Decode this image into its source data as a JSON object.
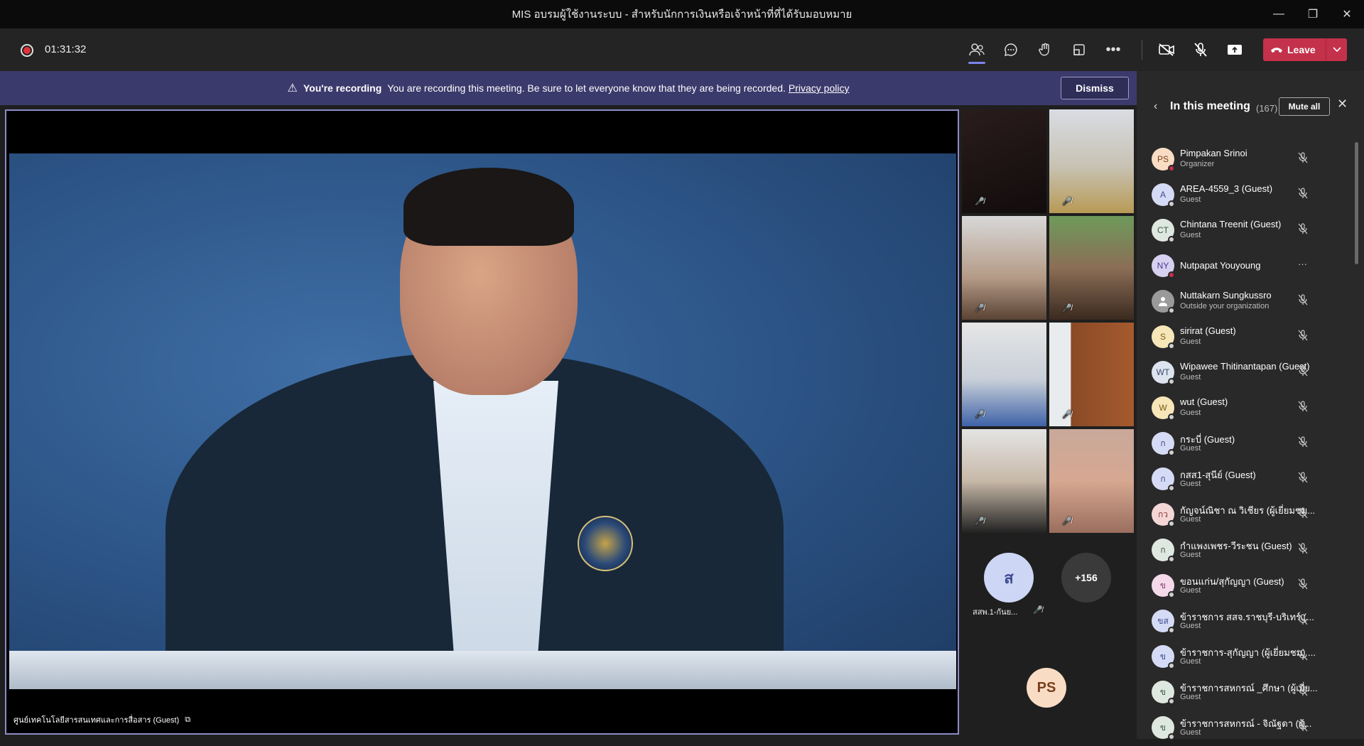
{
  "window": {
    "title": "MIS อบรมผู้ใช้งานระบบ - สำหรับนักการเงินหรือเจ้าหน้าที่ที่ได้รับมอบหมาย"
  },
  "toolbar": {
    "timer": "01:31:32",
    "leave_label": "Leave"
  },
  "banner": {
    "title": "You're recording",
    "message": "You are recording this meeting. Be sure to let everyone know that they are being recorded.",
    "link": "Privacy policy",
    "dismiss_label": "Dismiss"
  },
  "main_video": {
    "caption": "ศูนย์เทคโนโลยีสารสนเทศและการสื่อสาร (Guest)"
  },
  "gallery": {
    "avatar_tile": {
      "initial": "ส",
      "name": "สสพ.1-กันย...",
      "color": "#cdd6f4"
    },
    "overflow_count": "+156",
    "organizer_initials": "PS"
  },
  "panel": {
    "title": "In this meeting",
    "count": "(167)",
    "mute_all_label": "Mute all",
    "participants": [
      {
        "initials": "PS",
        "name": "Pimpakan Srinoi",
        "role": "Organizer",
        "avatar_color": "#f9dcc4",
        "text_color": "#7a3e1c",
        "status": "#c4314b"
      },
      {
        "initials": "A",
        "name": "AREA-4559_3 (Guest)",
        "role": "Guest",
        "avatar_color": "#d6dbf5",
        "text_color": "#3d4b8f",
        "status": "#cfcfcf"
      },
      {
        "initials": "CT",
        "name": "Chintana Treenit (Guest)",
        "role": "Guest",
        "avatar_color": "#dfe8e0",
        "text_color": "#3a5a40",
        "status": "#cfcfcf"
      },
      {
        "initials": "NY",
        "name": "Nutpapat Youyoung",
        "role": "",
        "avatar_color": "#d8d0f0",
        "text_color": "#4b3d8f",
        "status": "#c4314b"
      },
      {
        "initials": "",
        "name": "Nuttakarn Sungkussro",
        "role": "Outside your organization",
        "avatar_color": "#9a9a9a",
        "text_color": "#ffffff",
        "status": "#cfcfcf"
      },
      {
        "initials": "S",
        "name": "sirirat (Guest)",
        "role": "Guest",
        "avatar_color": "#f7e6b8",
        "text_color": "#7a5a10",
        "status": "#cfcfcf"
      },
      {
        "initials": "WT",
        "name": "Wipawee Thitinantapan (Guest)",
        "role": "Guest",
        "avatar_color": "#dde4ef",
        "text_color": "#3a4c6a",
        "status": "#cfcfcf"
      },
      {
        "initials": "W",
        "name": "wut (Guest)",
        "role": "Guest",
        "avatar_color": "#f7e6b8",
        "text_color": "#7a5a10",
        "status": "#cfcfcf"
      },
      {
        "initials": "ก",
        "name": "กระบี่ (Guest)",
        "role": "Guest",
        "avatar_color": "#d6dbf5",
        "text_color": "#3d4b8f",
        "status": "#cfcfcf"
      },
      {
        "initials": "ก",
        "name": "กสส1-สุนีย์ (Guest)",
        "role": "Guest",
        "avatar_color": "#d6dbf5",
        "text_color": "#3d4b8f",
        "status": "#cfcfcf"
      },
      {
        "initials": "กว",
        "name": "กัญจน์ณิชา ณ วิเชียร (ผู้เยี่ยมชม...",
        "role": "Guest",
        "avatar_color": "#f5d6d6",
        "text_color": "#8a3a3a",
        "status": "#cfcfcf"
      },
      {
        "initials": "ก",
        "name": "กำแพงเพชร-วีระชน (Guest)",
        "role": "Guest",
        "avatar_color": "#dfe8e0",
        "text_color": "#3a5a40",
        "status": "#cfcfcf"
      },
      {
        "initials": "ข",
        "name": "ขอนแก่น/สุกัญญา (Guest)",
        "role": "Guest",
        "avatar_color": "#f3d9ea",
        "text_color": "#8a3a6a",
        "status": "#cfcfcf"
      },
      {
        "initials": "ขส",
        "name": "ข้าราชการ สสจ.ราชบุรี-บริเทร์ (...",
        "role": "Guest",
        "avatar_color": "#d6dbf5",
        "text_color": "#3d4b8f",
        "status": "#cfcfcf"
      },
      {
        "initials": "ข",
        "name": "ข้าราชการ-สุกัญญา (ผู้เยี่ยมชม) ...",
        "role": "Guest",
        "avatar_color": "#d6dbf5",
        "text_color": "#3d4b8f",
        "status": "#cfcfcf"
      },
      {
        "initials": "ข",
        "name": "ข้าราชการสหกรณ์ _ศึกษา (ผู้เยี่ย...",
        "role": "Guest",
        "avatar_color": "#dfe8e0",
        "text_color": "#3a5a40",
        "status": "#cfcfcf"
      },
      {
        "initials": "ข",
        "name": "ข้าราชการสหกรณ์ - จิณัฐดา (ผู้...",
        "role": "Guest",
        "avatar_color": "#dfe8e0",
        "text_color": "#3a5a40",
        "status": "#cfcfcf"
      }
    ]
  }
}
